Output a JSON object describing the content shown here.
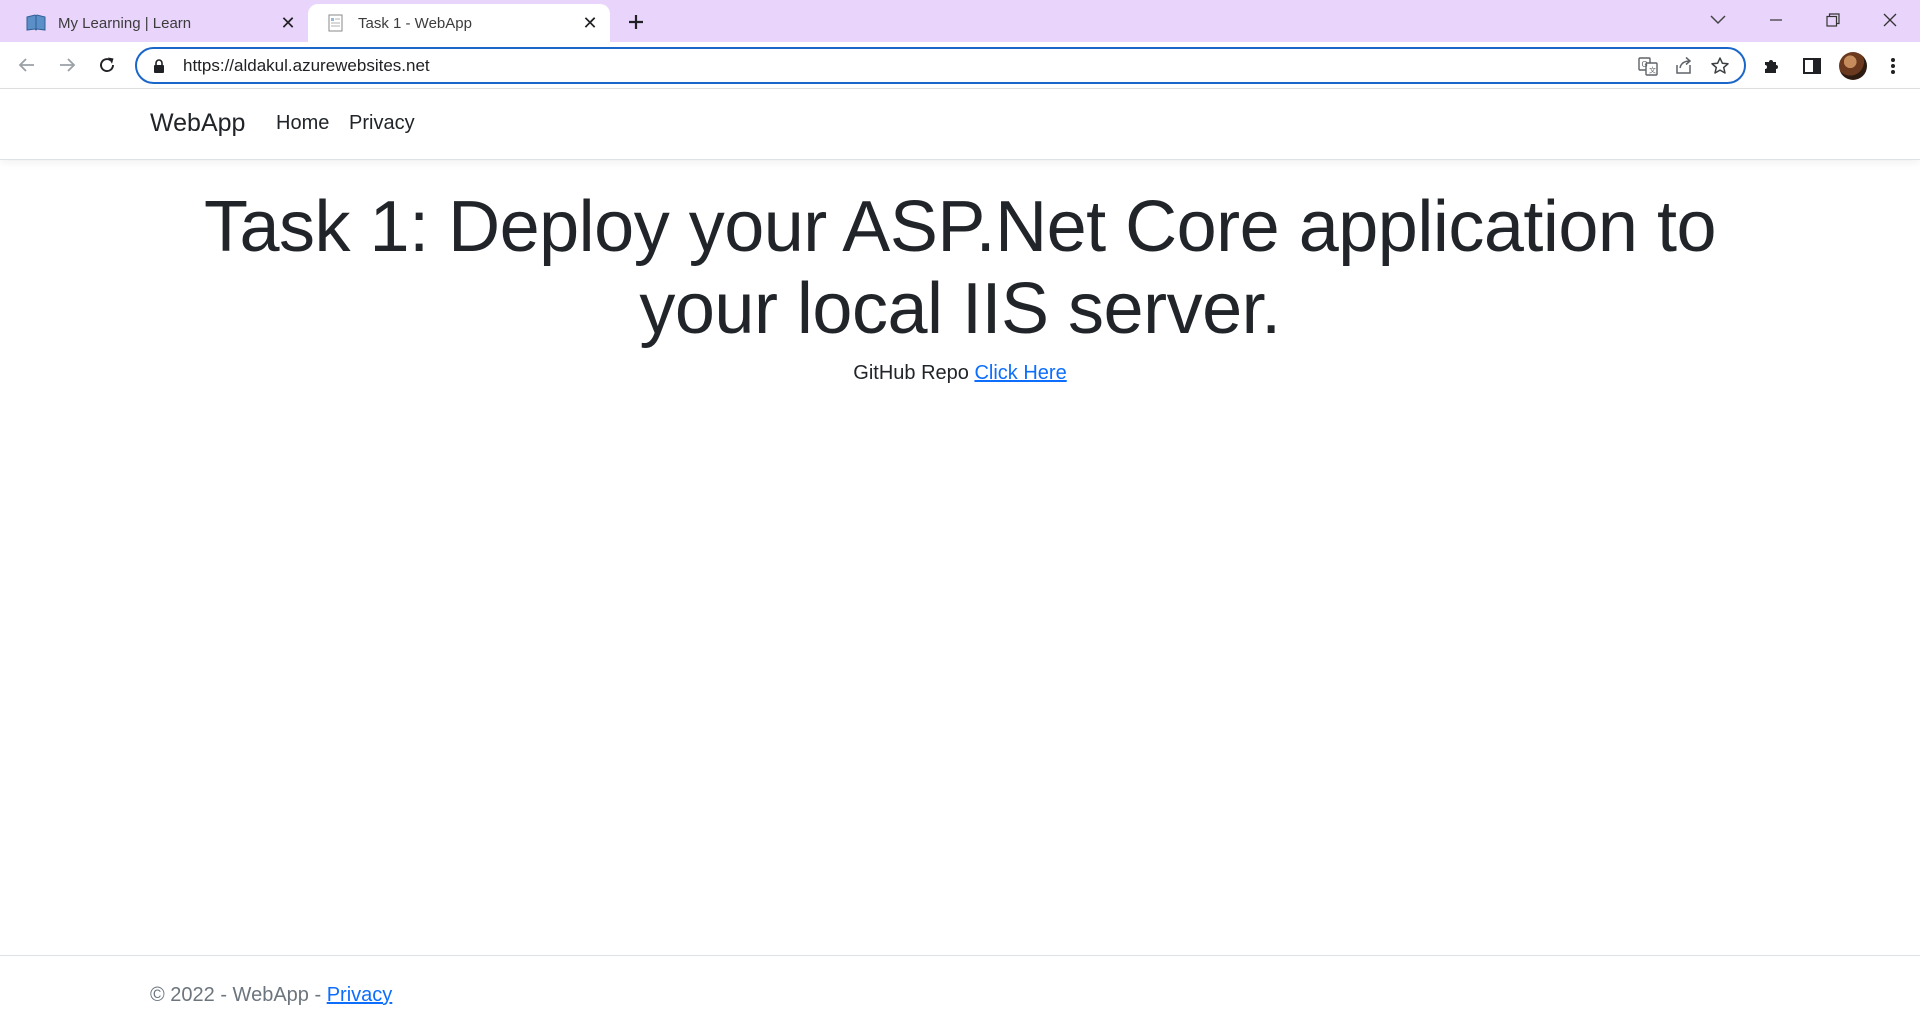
{
  "browser": {
    "tabs": [
      {
        "title": "My Learning | Learn",
        "favicon": "learn-book-icon",
        "active": false
      },
      {
        "title": "Task 1 - WebApp",
        "favicon": "page-icon",
        "active": true
      }
    ],
    "url": "https://aldakul.azurewebsites.net",
    "accent": "#1a66c9",
    "tabstrip_color": "#e9d5fb"
  },
  "site": {
    "brand": "WebApp",
    "nav": [
      {
        "label": "Home"
      },
      {
        "label": "Privacy"
      }
    ],
    "heading": "Task 1: Deploy your ASP.Net Core application to your local IIS server.",
    "repo_prefix": "GitHub Repo",
    "repo_link": "Click Here",
    "footer_text": "© 2022 - WebApp -",
    "footer_link": "Privacy",
    "link_color": "#0d6efd"
  }
}
